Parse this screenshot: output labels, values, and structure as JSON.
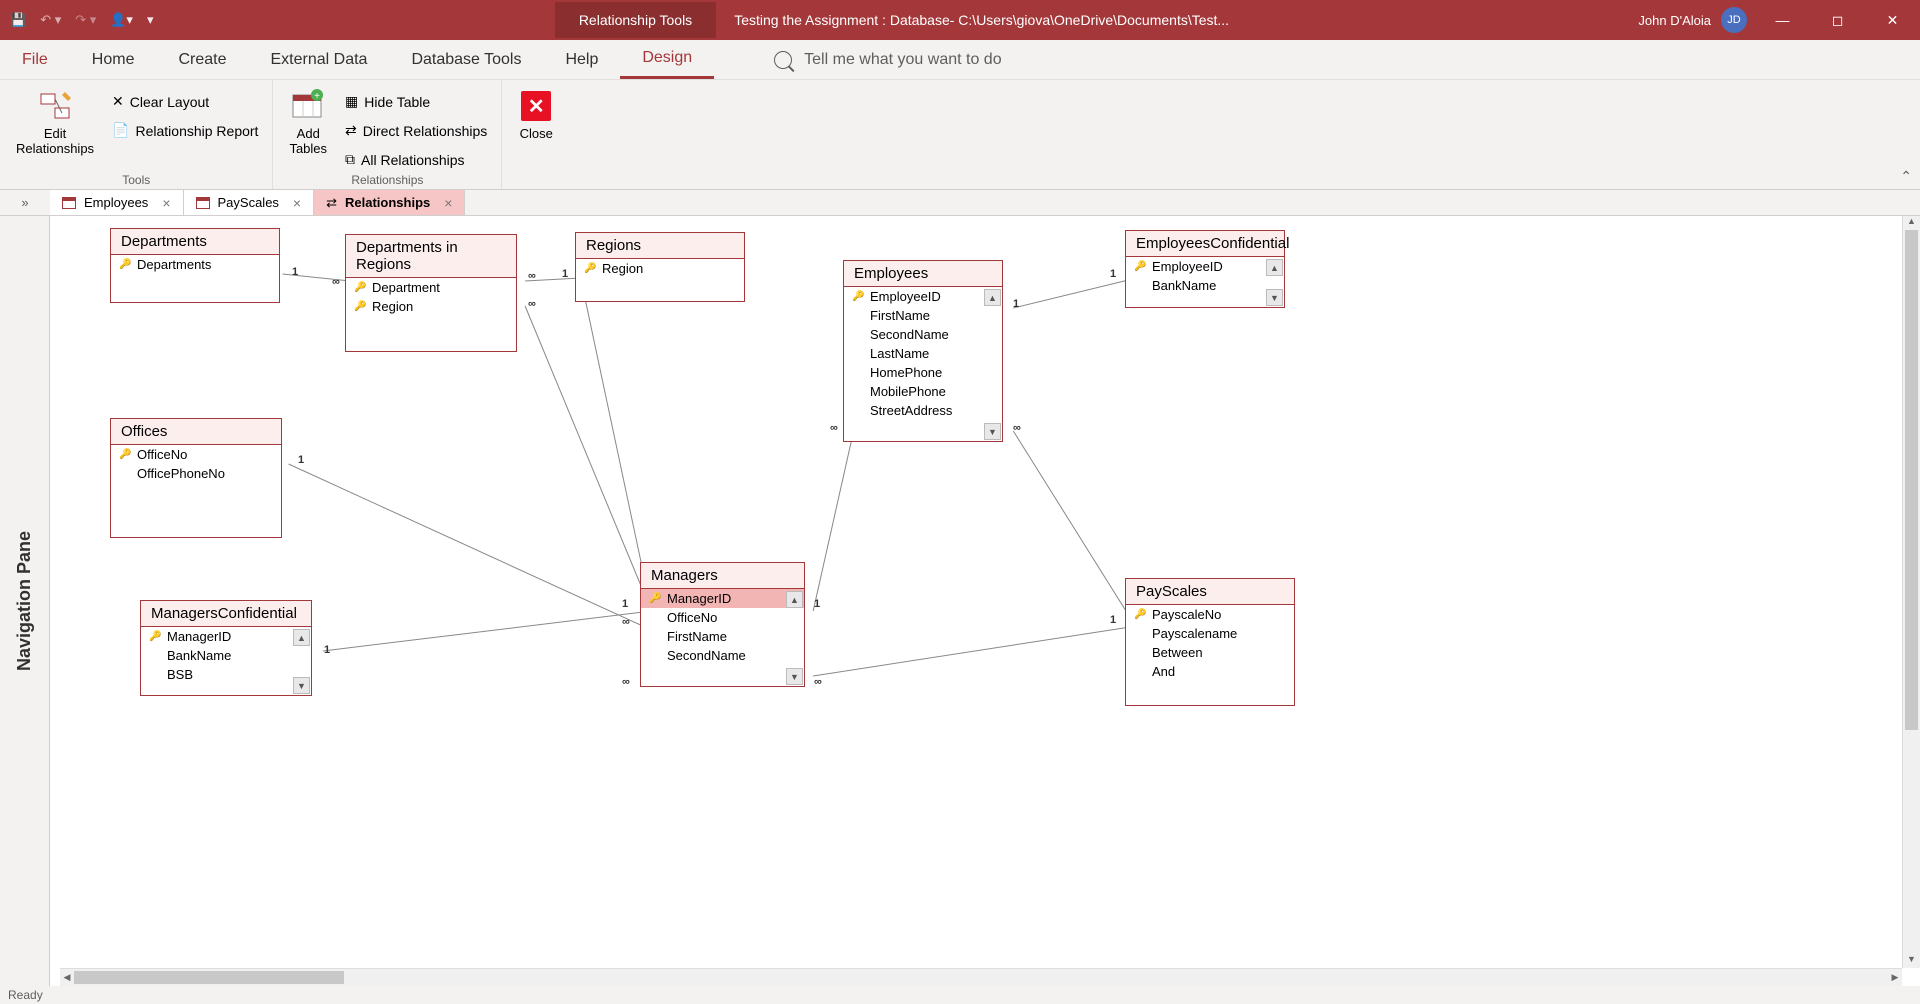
{
  "titlebar": {
    "tools_label": "Relationship Tools",
    "doc_title": "Testing the Assignment : Database- C:\\Users\\giova\\OneDrive\\Documents\\Test...",
    "user_name": "John D'Aloia",
    "user_initials": "JD"
  },
  "menus": {
    "file": "File",
    "home": "Home",
    "create": "Create",
    "external": "External Data",
    "dbtools": "Database Tools",
    "help": "Help",
    "design": "Design",
    "tellme": "Tell me what you want to do"
  },
  "ribbon": {
    "edit_rel": "Edit\nRelationships",
    "clear_layout": "Clear Layout",
    "rel_report": "Relationship Report",
    "tools_label": "Tools",
    "add_tables": "Add\nTables",
    "hide_table": "Hide Table",
    "direct_rel": "Direct Relationships",
    "all_rel": "All Relationships",
    "rel_label": "Relationships",
    "close": "Close"
  },
  "doctabs": {
    "t0": "Employees",
    "t1": "PayScales",
    "t2": "Relationships"
  },
  "nav_label": "Navigation Pane",
  "status": "Ready",
  "tables": {
    "Departments": {
      "title": "Departments",
      "f0": "Departments"
    },
    "DepartmentsInRegions": {
      "title": "Departments in Regions",
      "f0": "Department",
      "f1": "Region"
    },
    "Regions": {
      "title": "Regions",
      "f0": "Region"
    },
    "Employees": {
      "title": "Employees",
      "f0": "EmployeeID",
      "f1": "FirstName",
      "f2": "SecondName",
      "f3": "LastName",
      "f4": "HomePhone",
      "f5": "MobilePhone",
      "f6": "StreetAddress"
    },
    "EmployeesConfidential": {
      "title": "EmployeesConfidential",
      "f0": "EmployeeID",
      "f1": "BankName"
    },
    "Offices": {
      "title": "Offices",
      "f0": "OfficeNo",
      "f1": "OfficePhoneNo"
    },
    "ManagersConfidential": {
      "title": "ManagersConfidential",
      "f0": "ManagerID",
      "f1": "BankName",
      "f2": "BSB"
    },
    "Managers": {
      "title": "Managers",
      "f0": "ManagerID",
      "f1": "OfficeNo",
      "f2": "FirstName",
      "f3": "SecondName"
    },
    "PayScales": {
      "title": "PayScales",
      "f0": "PayscaleNo",
      "f1": "Payscalename",
      "f2": "Between",
      "f3": "And"
    }
  },
  "card": {
    "one": "1",
    "inf": "∞"
  }
}
